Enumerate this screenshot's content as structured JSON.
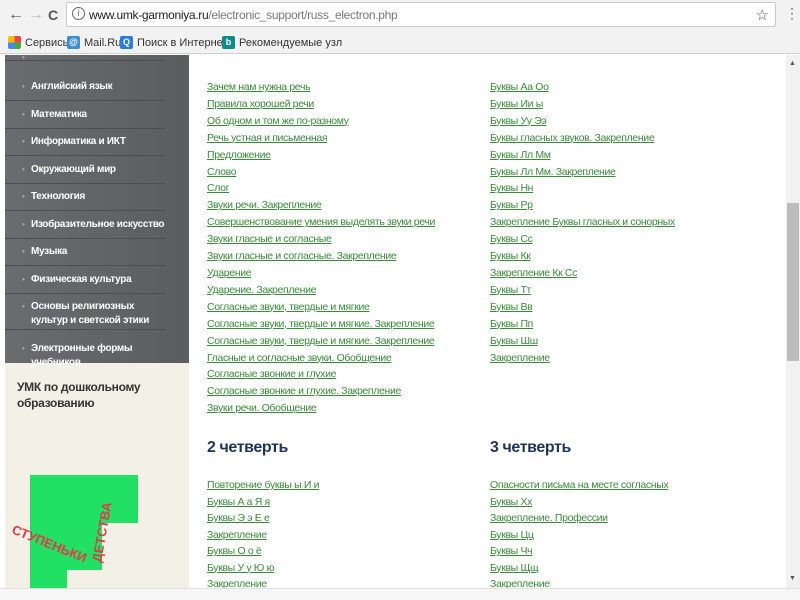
{
  "browser": {
    "url_domain": "www.umk-garmoniya.ru",
    "url_path": "/electronic_support/russ_electron.php",
    "back": "←",
    "forward": "→",
    "reload": "C",
    "star": "☆",
    "menu": "⋮"
  },
  "bookmarks": [
    {
      "label": "Сервисы"
    },
    {
      "label": "Mail.Ru"
    },
    {
      "label": "Поиск в Интернете"
    },
    {
      "label": "Рекомендуемые узл"
    }
  ],
  "sidebar": {
    "items": [
      "Английский язык",
      "Математика",
      "Информатика и ИКТ",
      "Окружающий мир",
      "Технология",
      "Изобразительное искусство",
      "Музыка",
      "Физическая культура",
      "Основы религиозных культур и светской этики",
      "Электронные формы учебников"
    ],
    "umk_title": "УМК по дошкольному образованию",
    "logo_text": [
      "СТУПЕНЬКИ",
      "ДЕТСТВА"
    ]
  },
  "col1": [
    "Зачем нам нужна речь",
    "Правила хорошей речи",
    "Об одном и том же по-разному",
    "Речь устная и письменная",
    "Предложение",
    "Слово",
    "Слог",
    "Звуки речи. Закрепление",
    "Совершенствование умения выделять звуки речи",
    "Звуки гласные и согласные",
    "Звуки гласные и согласные. Закрепление",
    "Ударение",
    "Ударение. Закрепление",
    "Согласные звуки, твердые и мягкие",
    "Согласные звуки, твердые и мягкие. Закрепление",
    "Согласные звуки, твердые и мягкие. Закрепление",
    "Гласные и согласные звуки. Обобщение",
    "Согласные звонкие и глухие",
    "Согласные звонкие и глухие. Закрепление",
    "Звуки речи. Обобщение"
  ],
  "col2": [
    "Буквы Аа Оо",
    "Буквы Ии ы",
    "Буквы Уу Ээ",
    "Буквы гласных звуков. Закрепление",
    "Буквы Лл Мм",
    "Буквы Лл Мм. Закрепление",
    "Буквы Нн",
    "Буквы Рр",
    "Закрепление Буквы гласных и сонорных",
    "Буквы Сс",
    "Буквы Кк",
    "Закрепление Кк Сс",
    "Буквы Тт",
    "Буквы Вв",
    "Буквы Пп",
    "Буквы Шш",
    "Закрепление"
  ],
  "q2": {
    "title": "2 четверть",
    "links": [
      "Повторение буквы ы И и",
      "Буквы А а Я я",
      "Буквы Э э Е е",
      "Закрепление",
      "Буквы О о ё",
      "Буквы У у Ю ю",
      "Закрепление"
    ]
  },
  "q3": {
    "title": "3 четверть",
    "links": [
      "Опасности письма на месте согласных",
      "Буквы Хх",
      "Закрепление. Профессии",
      "Буквы Цц",
      "Буквы Чч",
      "Буквы Щщ",
      "Закрепление"
    ]
  },
  "colors": {
    "link": "#3a8a3a",
    "heading": "#1e3558",
    "sidebar": "#616367",
    "logo_green": "#22e063",
    "logo_red": "#e03a4a"
  }
}
